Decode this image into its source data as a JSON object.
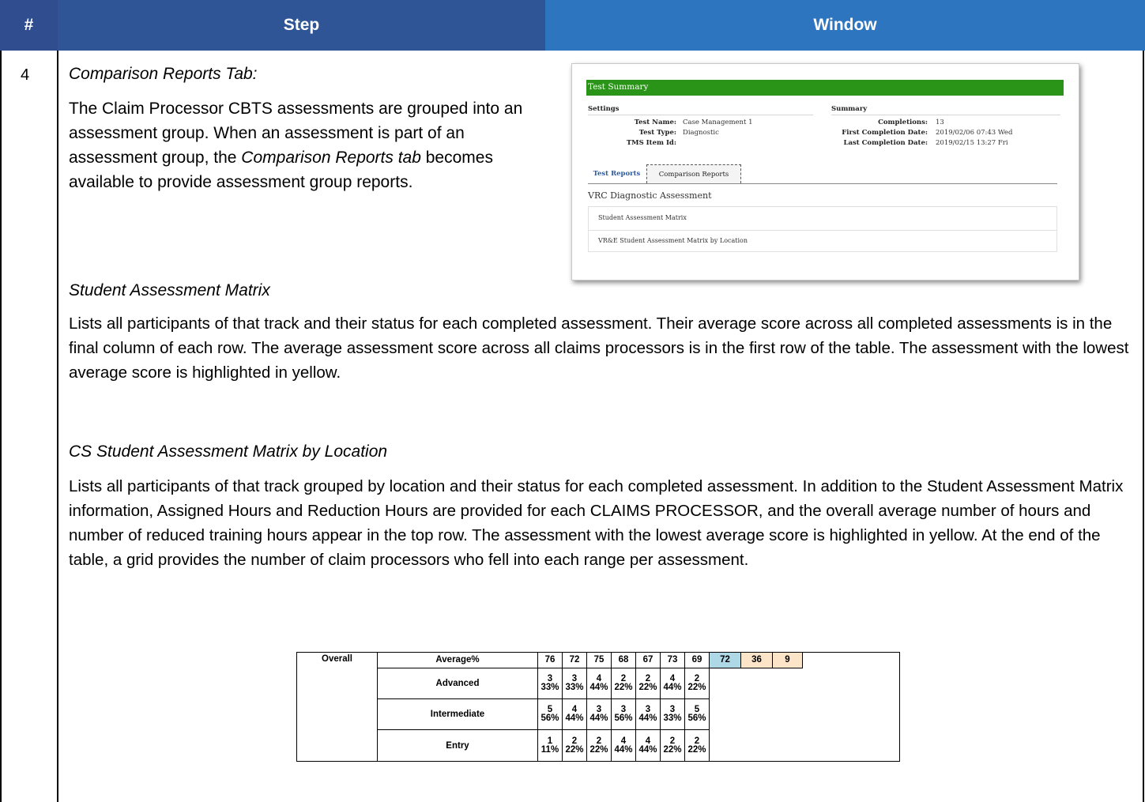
{
  "header": {
    "num": "#",
    "step": "Step",
    "window": "Window"
  },
  "row": {
    "number": "4",
    "title": "Comparison Reports Tab:",
    "intro_1": "The Claim Processor CBTS assessments are grouped into an assessment group. When an assessment is part of an assessment group, the ",
    "intro_italic": "Comparison Reports tab",
    "intro_2": " becomes available to provide assessment group reports.",
    "sections": [
      {
        "heading": "Student Assessment Matrix",
        "body": "Lists all participants of that track and their status for each completed assessment. Their average score across all completed assessments is in the final column of each row. The average assessment score across all claims processors is in the first row of the table. The assessment with the lowest average score is highlighted in yellow."
      },
      {
        "heading": "CS Student Assessment Matrix by Location",
        "body": "Lists all participants of that track grouped by location and their status for each completed assessment. In addition to the Student Assessment Matrix information, Assigned Hours and Reduction Hours are provided for each CLAIMS PROCESSOR, and the overall average number of hours and number of reduced training hours appear in the top row. The assessment with the lowest average score is highlighted in yellow. At the end of the table, a grid provides the number of claim processors who fell into each range per assessment."
      }
    ]
  },
  "screenshot": {
    "bar_title": "Test Summary",
    "settings_label": "Settings",
    "summary_label": "Summary",
    "settings": [
      {
        "key": "Test Name:",
        "value": "Case Management 1"
      },
      {
        "key": "Test Type:",
        "value": "Diagnostic"
      },
      {
        "key": "TMS Item Id:",
        "value": ""
      }
    ],
    "summary": [
      {
        "key": "Completions:",
        "value": "13"
      },
      {
        "key": "First Completion Date:",
        "value": "2019/02/06 07:43 Wed"
      },
      {
        "key": "Last Completion Date:",
        "value": "2019/02/15 13:27 Fri"
      }
    ],
    "tabs": {
      "test_reports": "Test Reports",
      "comparison_reports": "Comparison Reports"
    },
    "heading": "VRC Diagnostic Assessment",
    "list": [
      "Student Assessment Matrix",
      "VR&E Student Assessment Matrix by Location"
    ]
  },
  "matrix": {
    "overall_label": "Overall",
    "average_label": "Average%",
    "averages": [
      "76",
      "72",
      "75",
      "68",
      "67",
      "73",
      "69"
    ],
    "extra": [
      "72",
      "36",
      "9"
    ],
    "rows": [
      {
        "label": "Advanced",
        "counts": [
          "3",
          "3",
          "4",
          "2",
          "2",
          "4",
          "2"
        ],
        "pcts": [
          "33%",
          "33%",
          "44%",
          "22%",
          "22%",
          "44%",
          "22%"
        ]
      },
      {
        "label": "Intermediate",
        "counts": [
          "5",
          "4",
          "3",
          "3",
          "3",
          "3",
          "5"
        ],
        "pcts": [
          "56%",
          "44%",
          "44%",
          "56%",
          "44%",
          "33%",
          "56%"
        ]
      },
      {
        "label": "Entry",
        "counts": [
          "1",
          "2",
          "2",
          "4",
          "4",
          "2",
          "2"
        ],
        "pcts": [
          "11%",
          "22%",
          "22%",
          "44%",
          "44%",
          "22%",
          "22%"
        ]
      }
    ]
  }
}
